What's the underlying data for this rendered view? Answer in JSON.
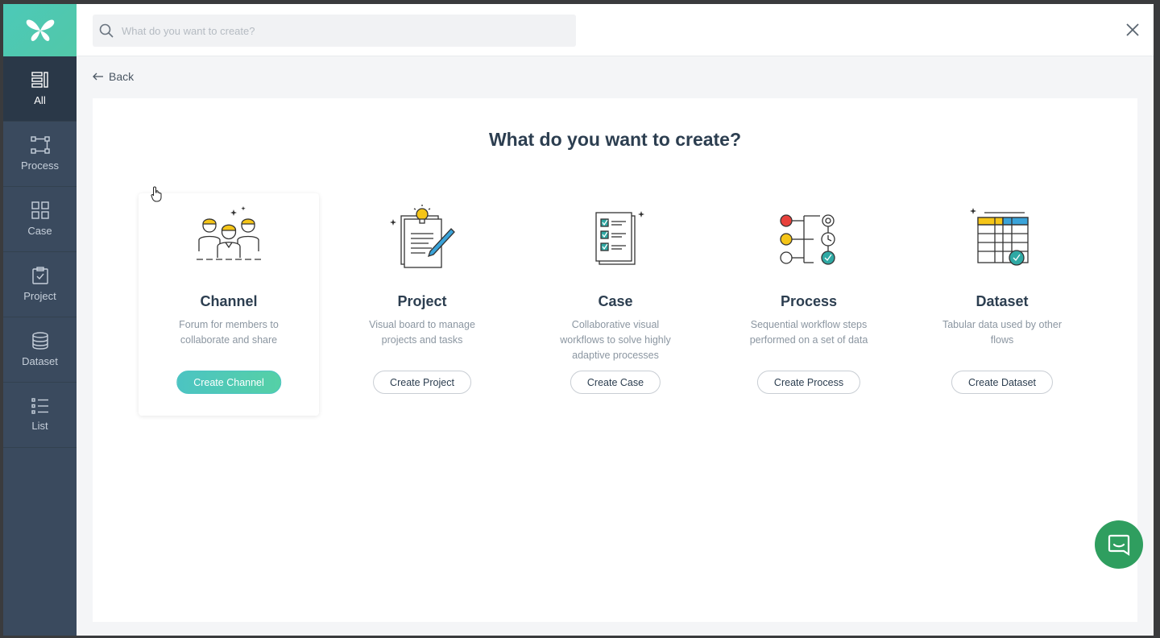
{
  "sidebar": {
    "items": [
      {
        "label": "All",
        "icon": "all-icon",
        "active": true
      },
      {
        "label": "Process",
        "icon": "process-icon"
      },
      {
        "label": "Case",
        "icon": "case-icon"
      },
      {
        "label": "Project",
        "icon": "project-icon"
      },
      {
        "label": "Dataset",
        "icon": "dataset-icon"
      },
      {
        "label": "List",
        "icon": "list-icon"
      }
    ]
  },
  "search": {
    "placeholder": "What do you want to create?"
  },
  "back_label": "Back",
  "main": {
    "title": "What do you want to create?",
    "cards": [
      {
        "title": "Channel",
        "desc": "Forum for members to collaborate and share",
        "button": "Create Channel",
        "icon": "team-icon"
      },
      {
        "title": "Project",
        "desc": "Visual board to manage projects and tasks",
        "button": "Create Project",
        "icon": "project-board-icon"
      },
      {
        "title": "Case",
        "desc": "Collaborative visual workflows to solve highly adaptive processes",
        "button": "Create Case",
        "icon": "checklist-icon"
      },
      {
        "title": "Process",
        "desc": "Sequential workflow steps performed on a set of data",
        "button": "Create Process",
        "icon": "workflow-icon"
      },
      {
        "title": "Dataset",
        "desc": "Tabular data used by other flows",
        "button": "Create Dataset",
        "icon": "table-icon"
      }
    ]
  },
  "colors": {
    "sidebar": "#3a4a5e",
    "sidebar_active": "#2a3848",
    "accent": "#4cc4c2",
    "chat": "#2f9e5f"
  }
}
